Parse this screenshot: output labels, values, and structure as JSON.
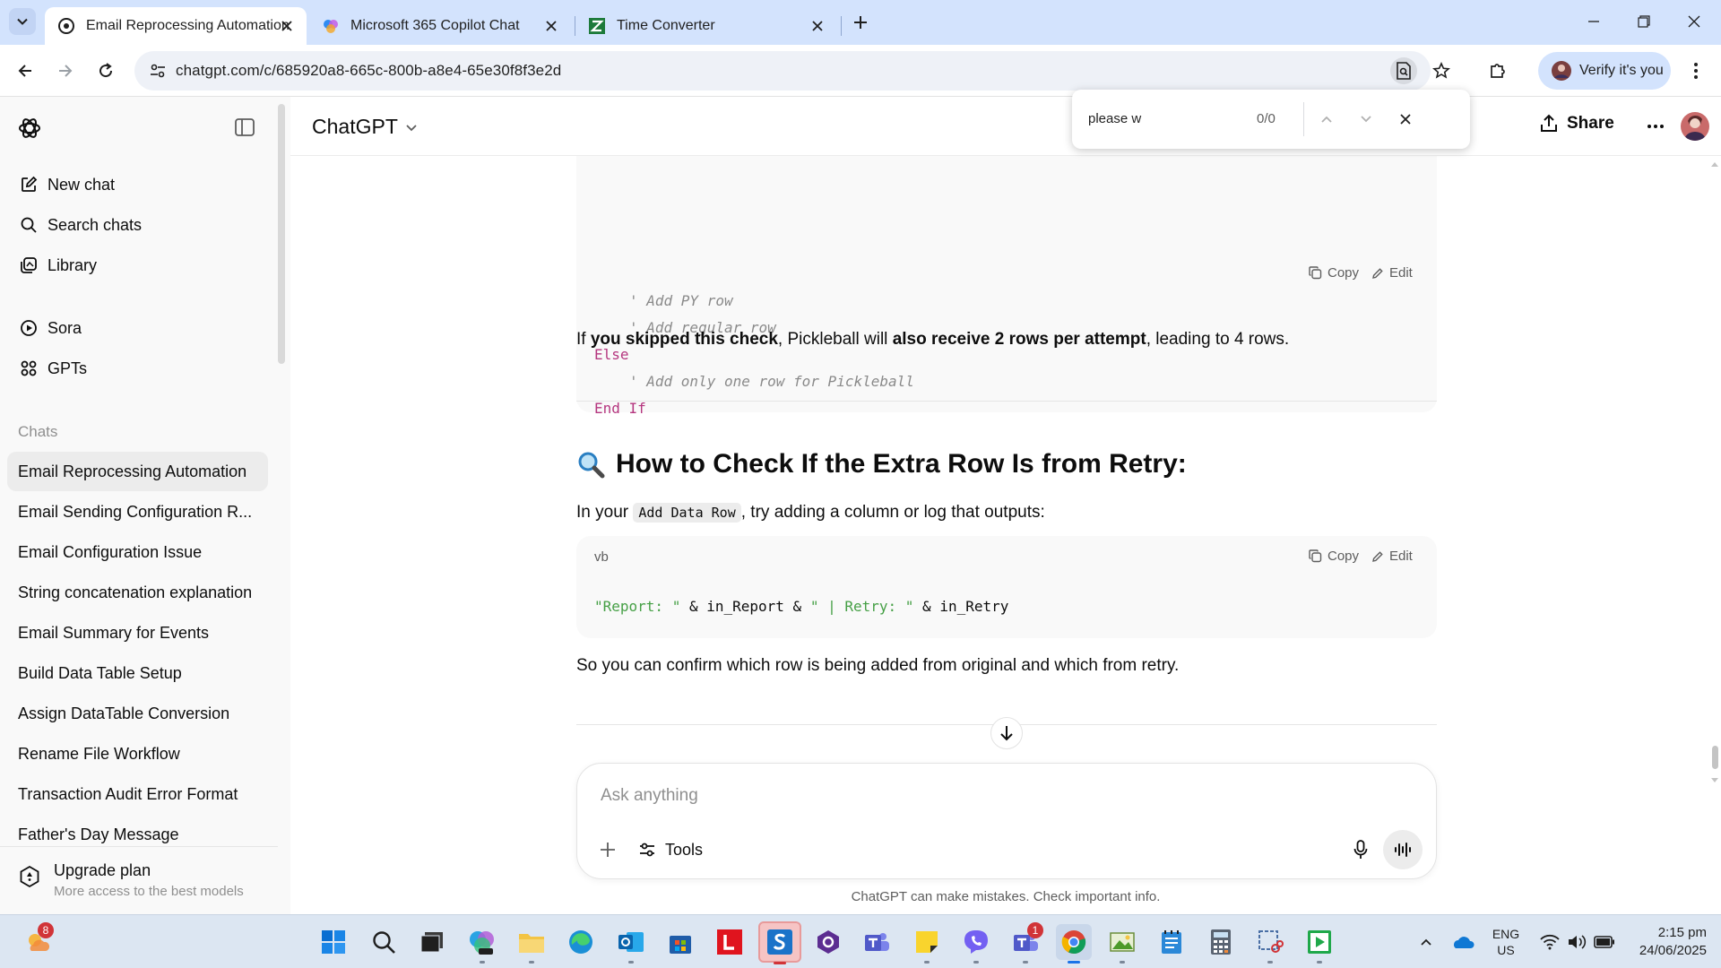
{
  "browser": {
    "tabs": [
      {
        "title": "Email Reprocessing Automation",
        "active": true,
        "icon": "chatgpt-icon"
      },
      {
        "title": "Microsoft 365 Copilot Chat",
        "active": false,
        "icon": "copilot-icon"
      },
      {
        "title": "Time Converter",
        "active": false,
        "icon": "time-converter-icon"
      }
    ],
    "url": "chatgpt.com/c/685920a8-665c-800b-a8e4-65e30f8f3e2d",
    "verify_label": "Verify it's you"
  },
  "sidebar": {
    "nav": [
      {
        "label": "New chat",
        "icon": "new-chat-icon"
      },
      {
        "label": "Search chats",
        "icon": "search-icon"
      },
      {
        "label": "Library",
        "icon": "library-icon"
      },
      {
        "label": "Sora",
        "icon": "sora-icon"
      },
      {
        "label": "GPTs",
        "icon": "gpts-icon"
      }
    ],
    "chats_label": "Chats",
    "chats": [
      "Email Reprocessing Automation",
      "Email Sending Configuration R...",
      "Email Configuration Issue",
      "String concatenation explanation",
      "Email Summary for Events",
      "Build Data Table Setup",
      "Assign DataTable Conversion",
      "Rename File Workflow",
      "Transaction Audit Error Format",
      "Father's Day Message"
    ],
    "upgrade": {
      "title": "Upgrade plan",
      "subtitle": "More access to the best models"
    }
  },
  "header": {
    "model": "ChatGPT",
    "share_label": "Share"
  },
  "find_bar": {
    "query": "please w",
    "count": "0/0"
  },
  "message": {
    "code1": {
      "lines": [
        {
          "text": "' Add PY row",
          "kind": "comment",
          "indent": 2
        },
        {
          "text": "' Add regular row",
          "kind": "comment",
          "indent": 2
        },
        {
          "text": "Else",
          "kind": "keyword",
          "indent": 0
        },
        {
          "text": "' Add only one row for Pickleball",
          "kind": "comment",
          "indent": 2
        },
        {
          "text": "End If",
          "kind": "keyword",
          "indent": 0
        }
      ],
      "copy_label": "Copy",
      "edit_label": "Edit"
    },
    "para1": {
      "a": "If ",
      "b": "you skipped this check",
      "c": ", Pickleball will ",
      "d": "also receive 2 rows per attempt",
      "e": ", leading to 4 rows."
    },
    "heading": {
      "emoji": "🔍",
      "text": "How to Check If the Extra Row Is from Retry:"
    },
    "para2": {
      "a": "In your ",
      "code": "Add Data Row",
      "b": ", try adding a column or log that outputs:"
    },
    "code2": {
      "lang": "vb",
      "copy_label": "Copy",
      "edit_label": "Edit",
      "tokens": [
        {
          "text": "\"Report: \"",
          "kind": "string"
        },
        {
          "text": " & in_Report & ",
          "kind": "plain"
        },
        {
          "text": "\" | Retry: \"",
          "kind": "string"
        },
        {
          "text": " & in_Retry",
          "kind": "plain"
        }
      ]
    },
    "para3": "So you can confirm which row is being added from original and which from retry."
  },
  "composer": {
    "placeholder": "Ask anything",
    "tools_label": "Tools"
  },
  "disclaimer": "ChatGPT can make mistakes. Check important info.",
  "taskbar": {
    "weather_badge": "8",
    "teams_badge": "1",
    "lang_top": "ENG",
    "lang_bottom": "US",
    "time": "2:15 pm",
    "date": "24/06/2025"
  }
}
